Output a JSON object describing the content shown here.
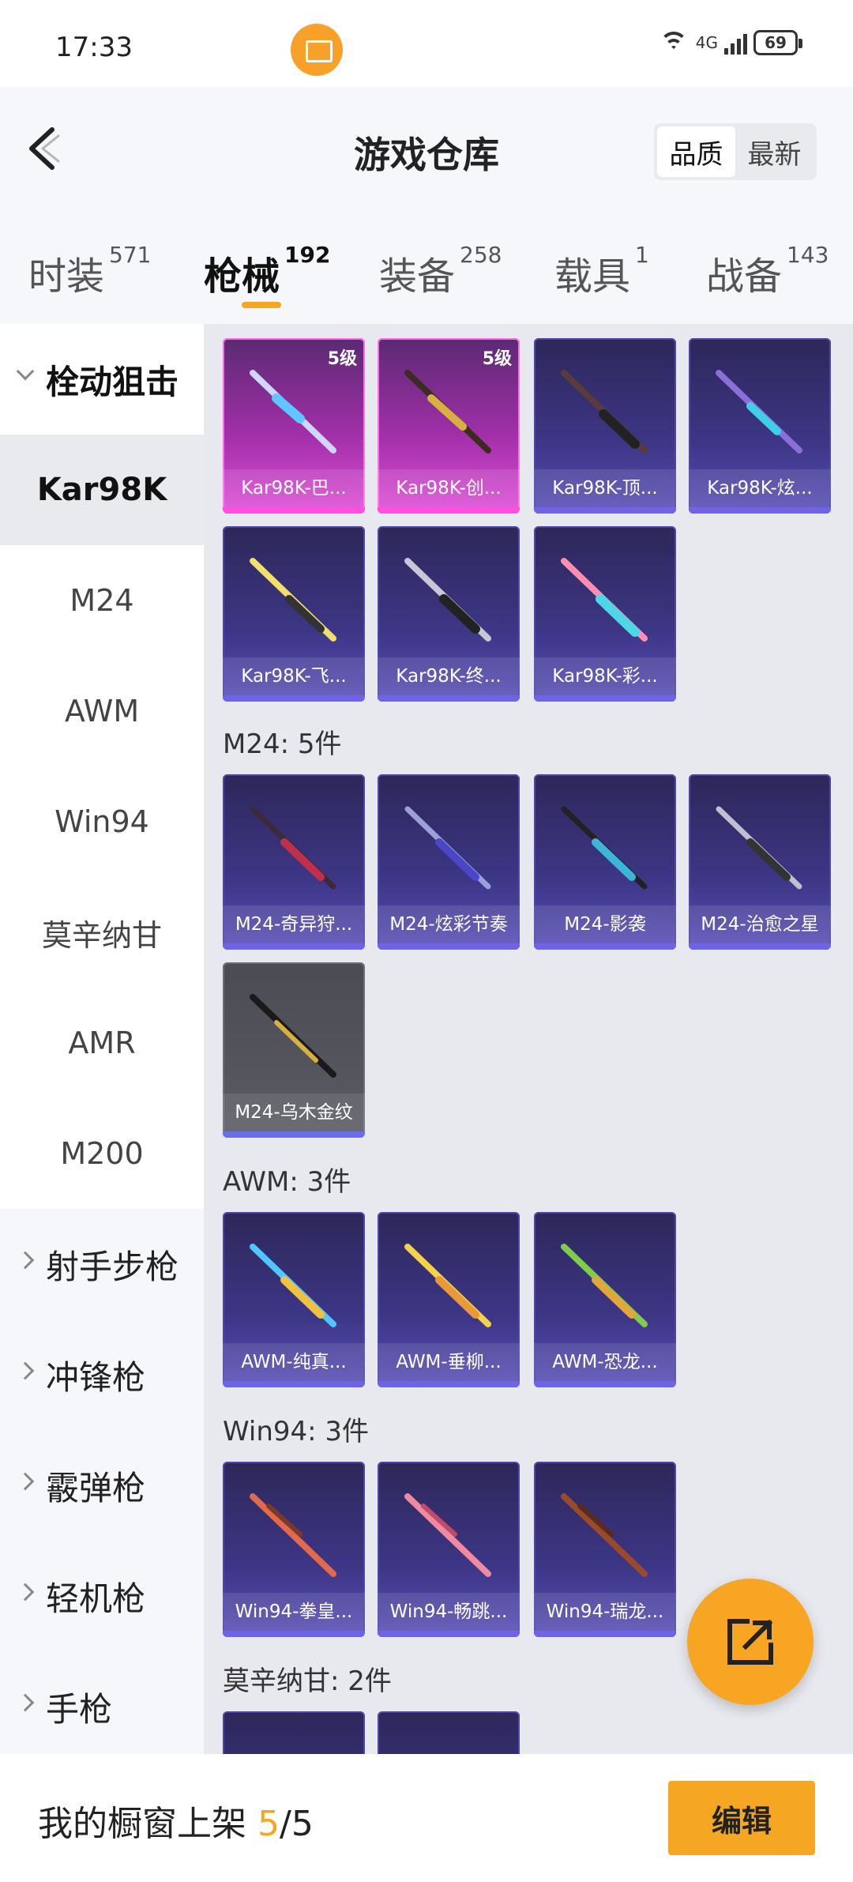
{
  "status": {
    "time": "17:33",
    "network": "4G",
    "battery": "69"
  },
  "header": {
    "title": "游戏仓库",
    "sort_quality": "品质",
    "sort_newest": "最新"
  },
  "tabs": [
    {
      "label": "时装",
      "count": "571"
    },
    {
      "label": "枪械",
      "count": "192"
    },
    {
      "label": "装备",
      "count": "258"
    },
    {
      "label": "载具",
      "count": "1"
    },
    {
      "label": "战备",
      "count": "143"
    }
  ],
  "sidebar": {
    "group_open": "栓动狙击",
    "items": [
      "Kar98K",
      "M24",
      "AWM",
      "Win94",
      "莫辛纳甘",
      "AMR",
      "M200"
    ],
    "groups": [
      "射手步枪",
      "冲锋枪",
      "霰弹枪",
      "轻机枪",
      "手枪"
    ]
  },
  "sections": {
    "kar98k": {
      "cards": [
        {
          "name": "Kar98K-巴...",
          "level": "5级",
          "rarity": "pink"
        },
        {
          "name": "Kar98K-创...",
          "level": "5级",
          "rarity": "pink"
        },
        {
          "name": "Kar98K-顶...",
          "rarity": "purple"
        },
        {
          "name": "Kar98K-炫...",
          "rarity": "purple"
        },
        {
          "name": "Kar98K-飞...",
          "rarity": "purple"
        },
        {
          "name": "Kar98K-终...",
          "rarity": "purple"
        },
        {
          "name": "Kar98K-彩...",
          "rarity": "purple"
        }
      ]
    },
    "m24": {
      "title": "M24: 5件",
      "cards": [
        {
          "name": "M24-奇异狩...",
          "rarity": "purple"
        },
        {
          "name": "M24-炫彩节奏",
          "rarity": "purple"
        },
        {
          "name": "M24-影袭",
          "rarity": "purple"
        },
        {
          "name": "M24-治愈之星",
          "rarity": "purple"
        },
        {
          "name": "M24-乌木金纹",
          "rarity": "gray"
        }
      ]
    },
    "awm": {
      "title": "AWM: 3件",
      "cards": [
        {
          "name": "AWM-纯真...",
          "rarity": "purple"
        },
        {
          "name": "AWM-垂柳...",
          "rarity": "purple"
        },
        {
          "name": "AWM-恐龙...",
          "rarity": "purple"
        }
      ]
    },
    "win94": {
      "title": "Win94: 3件",
      "cards": [
        {
          "name": "Win94-拳皇...",
          "rarity": "purple"
        },
        {
          "name": "Win94-畅跳...",
          "rarity": "purple"
        },
        {
          "name": "Win94-瑞龙...",
          "rarity": "purple"
        }
      ]
    },
    "mosin": {
      "title": "莫辛纳甘: 2件"
    }
  },
  "bottom": {
    "label": "我的橱窗上架",
    "current": "5",
    "total": "/5",
    "edit": "编辑"
  },
  "colors": {
    "accent": "#f5a623",
    "legendary": "#e04fd8",
    "epic": "#5a50b8",
    "common": "#5a5b63"
  }
}
